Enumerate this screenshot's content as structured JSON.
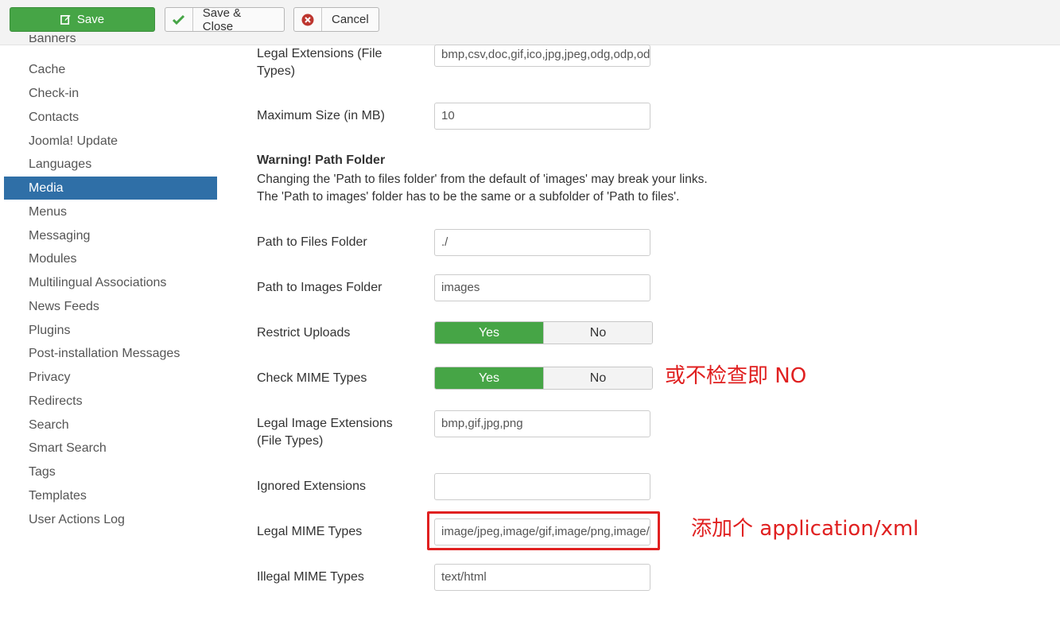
{
  "toolbar": {
    "save_label": "Save",
    "save_close_label": "Save & Close",
    "cancel_label": "Cancel"
  },
  "sidebar": {
    "items": [
      {
        "label": "Banners"
      },
      {
        "label": "Cache"
      },
      {
        "label": "Check-in"
      },
      {
        "label": "Contacts"
      },
      {
        "label": "Joomla! Update"
      },
      {
        "label": "Languages"
      },
      {
        "label": "Media",
        "active": true
      },
      {
        "label": "Menus"
      },
      {
        "label": "Messaging"
      },
      {
        "label": "Modules"
      },
      {
        "label": "Multilingual Associations"
      },
      {
        "label": "News Feeds"
      },
      {
        "label": "Plugins"
      },
      {
        "label": "Post-installation Messages"
      },
      {
        "label": "Privacy"
      },
      {
        "label": "Redirects"
      },
      {
        "label": "Search"
      },
      {
        "label": "Smart Search"
      },
      {
        "label": "Tags"
      },
      {
        "label": "Templates"
      },
      {
        "label": "User Actions Log"
      }
    ]
  },
  "form": {
    "legal_extensions": {
      "label_line1": "Legal Extensions (File",
      "label_line2": "Types)",
      "value": "bmp,csv,doc,gif,ico,jpg,jpeg,odg,odp,ods,odt,pdf"
    },
    "max_size": {
      "label": "Maximum Size (in MB)",
      "value": "10"
    },
    "warning": {
      "title": "Warning! Path Folder",
      "line1": "Changing the 'Path to files folder' from the default of 'images' may break your links.",
      "line2": "The 'Path to images' folder has to be the same or a subfolder of 'Path to files'."
    },
    "path_files": {
      "label": "Path to Files Folder",
      "value": "./"
    },
    "path_images": {
      "label": "Path to Images Folder",
      "value": "images"
    },
    "restrict_uploads": {
      "label": "Restrict Uploads",
      "yes": "Yes",
      "no": "No",
      "selected": "Yes"
    },
    "check_mime": {
      "label": "Check MIME Types",
      "yes": "Yes",
      "no": "No",
      "selected": "Yes"
    },
    "legal_image_ext": {
      "label_line1": "Legal Image Extensions",
      "label_line2": "(File Types)",
      "value": "bmp,gif,jpg,png"
    },
    "ignored_ext": {
      "label": "Ignored Extensions",
      "value": ""
    },
    "legal_mime": {
      "label": "Legal MIME Types",
      "value": "image/jpeg,image/gif,image/png,image/bmp"
    },
    "illegal_mime": {
      "label": "Illegal MIME Types",
      "value": "text/html"
    }
  },
  "annotations": {
    "check_mime_note": "或不检查即 NO",
    "legal_mime_note": "添加个 application/xml"
  },
  "colors": {
    "success": "#46a546",
    "active_nav": "#2f6fa7",
    "annotation": "#e02020"
  }
}
